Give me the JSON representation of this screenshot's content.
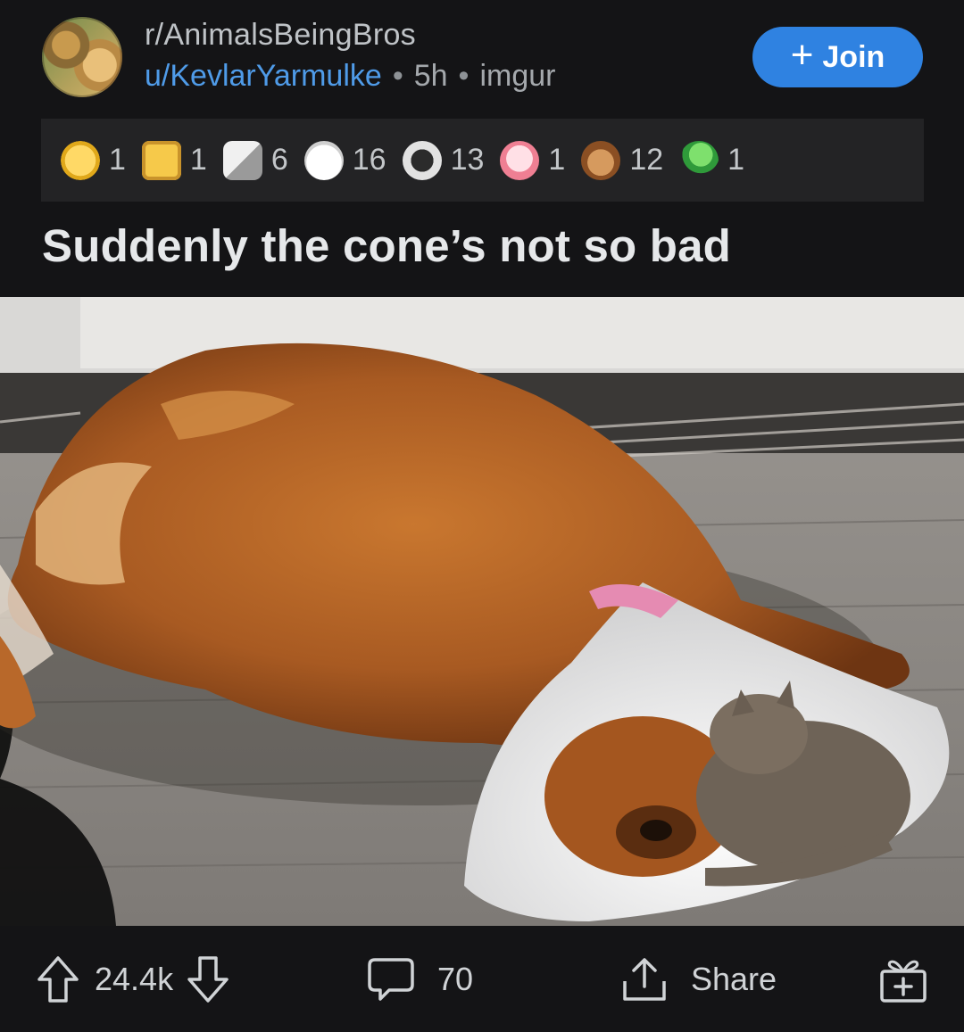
{
  "post": {
    "subreddit": "r/AnimalsBeingBros",
    "author": "u/KevlarYarmulke",
    "age": "5h",
    "source": "imgur",
    "join_label": "Join",
    "title": "Suddenly the cone’s not so bad"
  },
  "awards": [
    {
      "icon": "sun-face-award-icon",
      "count": "1",
      "color": "#f4c430"
    },
    {
      "icon": "star-badge-award-icon",
      "count": "1",
      "color": "#f6c94a"
    },
    {
      "icon": "handshake-award-icon",
      "count": "6",
      "color": "#e8e8e8"
    },
    {
      "icon": "wholesome-face-award-icon",
      "count": "16",
      "color": "#f2f2f2"
    },
    {
      "icon": "silver-s-award-icon",
      "count": "13",
      "color": "#dcdcdc"
    },
    {
      "icon": "heart-award-icon",
      "count": "1",
      "color": "#f28b9b"
    },
    {
      "icon": "bear-hug-award-icon",
      "count": "12",
      "color": "#b5713a"
    },
    {
      "icon": "snake-award-icon",
      "count": "1",
      "color": "#54c24e"
    }
  ],
  "footer": {
    "upvotes": "24.4k",
    "comments": "70",
    "share_label": "Share"
  },
  "colors": {
    "background": "#141416",
    "accent": "#2f82e1",
    "username": "#4f9be8",
    "award_bar": "#232325"
  }
}
